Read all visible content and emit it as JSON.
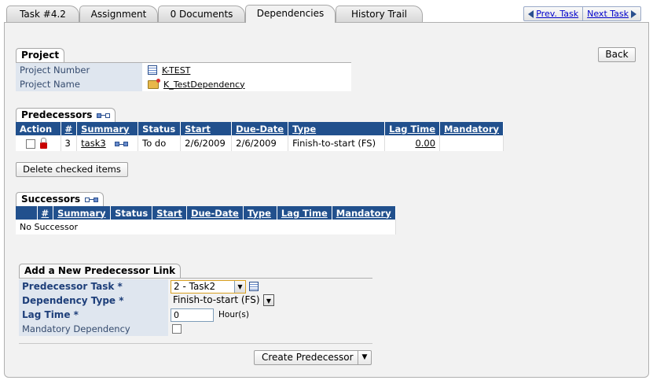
{
  "tabs": [
    {
      "label": "Task #4.2"
    },
    {
      "label": "Assignment"
    },
    {
      "label": "0 Documents"
    },
    {
      "label": "Dependencies",
      "active": true
    },
    {
      "label": "History Trail"
    }
  ],
  "nav": {
    "prev": "Prev. Task",
    "next": "Next Task"
  },
  "back_label": "Back",
  "project": {
    "section_title": "Project",
    "number_label": "Project Number",
    "number_value": "K-TEST",
    "name_label": "Project Name",
    "name_value": "K_TestDependency"
  },
  "predecessors": {
    "title": "Predecessors",
    "columns": [
      "Action",
      "#",
      "Summary",
      "Status",
      "Start",
      "Due-Date",
      "Type",
      "Lag Time",
      "Mandatory"
    ],
    "rows": [
      {
        "num": "3",
        "summary": "task3",
        "status": "To do",
        "start": "2/6/2009",
        "due": "2/6/2009",
        "type": "Finish-to-start (FS)",
        "lag": "0.00",
        "mandatory": ""
      }
    ],
    "delete_label": "Delete checked items"
  },
  "successors": {
    "title": "Successors",
    "columns": [
      "",
      "#",
      "Summary",
      "Status",
      "Start",
      "Due-Date",
      "Type",
      "Lag Time",
      "Mandatory"
    ],
    "empty_text": "No Successor"
  },
  "add_link": {
    "title": "Add a New Predecessor Link",
    "pred_task_label": "Predecessor Task *",
    "pred_task_value": "2 - Task2",
    "dep_type_label": "Dependency Type *",
    "dep_type_value": "Finish-to-start (FS)",
    "lag_label": "Lag Time *",
    "lag_value": "0",
    "lag_unit": "Hour(s)",
    "mandatory_label": "Mandatory Dependency",
    "create_label": "Create Predecessor"
  },
  "colors": {
    "header_blue": "#21508d",
    "label_bg": "#dfe6ef",
    "panel_bg": "#f2f2f2"
  }
}
